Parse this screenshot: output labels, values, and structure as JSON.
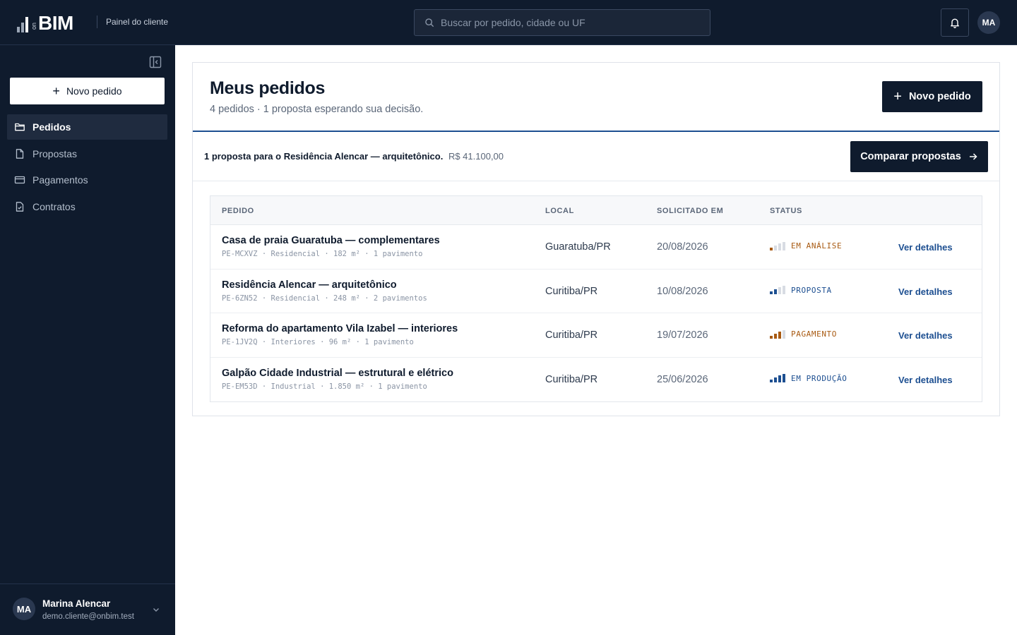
{
  "brand": {
    "logo_prefix": "on",
    "logo_text": "BIM",
    "subtitle": "Painel do cliente"
  },
  "search": {
    "placeholder": "Buscar por pedido, cidade ou UF"
  },
  "header_user": {
    "initials": "MA"
  },
  "sidebar": {
    "new_order_label": "Novo pedido",
    "items": [
      {
        "label": "Pedidos",
        "icon": "folder-icon",
        "active": true
      },
      {
        "label": "Propostas",
        "icon": "document-icon",
        "active": false
      },
      {
        "label": "Pagamentos",
        "icon": "credit-card-icon",
        "active": false
      },
      {
        "label": "Contratos",
        "icon": "contract-icon",
        "active": false
      }
    ],
    "user": {
      "initials": "MA",
      "name": "Marina Alencar",
      "email": "demo.cliente@onbim.test"
    }
  },
  "main": {
    "title": "Meus pedidos",
    "subtitle": "4 pedidos · 1 proposta esperando sua decisão.",
    "new_order_label": "Novo pedido",
    "banner": {
      "text": "1 proposta para o Residência Alencar — arquitetônico.",
      "amount": "R$ 41.100,00",
      "button_label": "Comparar propostas"
    },
    "table": {
      "columns": [
        "PEDIDO",
        "LOCAL",
        "SOLICITADO EM",
        "STATUS"
      ],
      "rows": [
        {
          "title": "Casa de praia Guaratuba — complementares",
          "meta": "PE-MCXVZ · Residencial · 182 m² · 1 pavimento",
          "local": "Guaratuba/PR",
          "date": "20/08/2026",
          "status": "EM ANÁLISE",
          "status_level": 1,
          "status_color": "#a85a12",
          "action": "Ver detalhes"
        },
        {
          "title": "Residência Alencar — arquitetônico",
          "meta": "PE-6ZN52 · Residencial · 248 m² · 2 pavimentos",
          "local": "Curitiba/PR",
          "date": "10/08/2026",
          "status": "PROPOSTA",
          "status_level": 2,
          "status_color": "#1d4f91",
          "action": "Ver detalhes"
        },
        {
          "title": "Reforma do apartamento Vila Izabel — interiores",
          "meta": "PE-1JV2Q · Interiores · 96 m² · 1 pavimento",
          "local": "Curitiba/PR",
          "date": "19/07/2026",
          "status": "PAGAMENTO",
          "status_level": 3,
          "status_color": "#a85a12",
          "action": "Ver detalhes"
        },
        {
          "title": "Galpão Cidade Industrial — estrutural e elétrico",
          "meta": "PE-EM53D · Industrial · 1.850 m² · 1 pavimento",
          "local": "Curitiba/PR",
          "date": "25/06/2026",
          "status": "EM PRODUÇÃO",
          "status_level": 4,
          "status_color": "#1d4f91",
          "action": "Ver detalhes"
        }
      ]
    }
  }
}
